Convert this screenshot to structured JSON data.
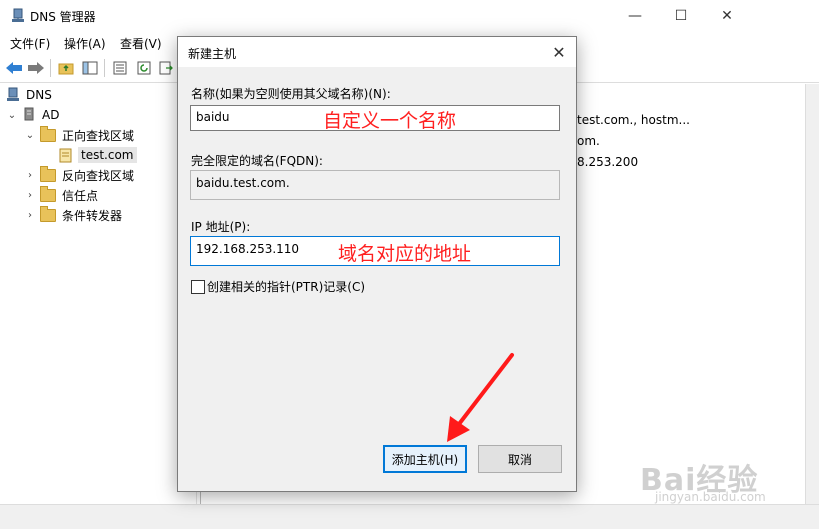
{
  "window": {
    "title": "DNS 管理器",
    "controls": [
      "minimize-icon",
      "maximize-icon",
      "close-icon"
    ]
  },
  "menu": [
    "文件(F)",
    "操作(A)",
    "查看(V)"
  ],
  "tree": {
    "root": "DNS",
    "server": "AD",
    "forward_zones": "正向查找区域",
    "zone": "test.com",
    "reverse_zones": "反向查找区域",
    "trust_points": "信任点",
    "conditional_forwarders": "条件转发器"
  },
  "right_pane": {
    "row1": "test.com., hostm...",
    "row2": "om.",
    "row3": "8.253.200"
  },
  "dialog": {
    "title": "新建主机",
    "name_label": "名称(如果为空则使用其父域名称)(N):",
    "name_value": "baidu",
    "name_annotation": "自定义一个名称",
    "fqdn_label": "完全限定的域名(FQDN):",
    "fqdn_value": "baidu.test.com.",
    "ip_label": "IP 地址(P):",
    "ip_value": "192.168.253.110",
    "ip_annotation": "域名对应的地址",
    "ptr_label": "创建相关的指针(PTR)记录(C)",
    "ptr_checked": false,
    "add_button": "添加主机(H)",
    "cancel_button": "取消"
  },
  "watermark": {
    "brand": "Bai经验",
    "url": "jingyan.baidu.com"
  },
  "colors": {
    "annotation": "#ff2020",
    "focus": "#0078d7",
    "folder": "#e8c25a"
  }
}
